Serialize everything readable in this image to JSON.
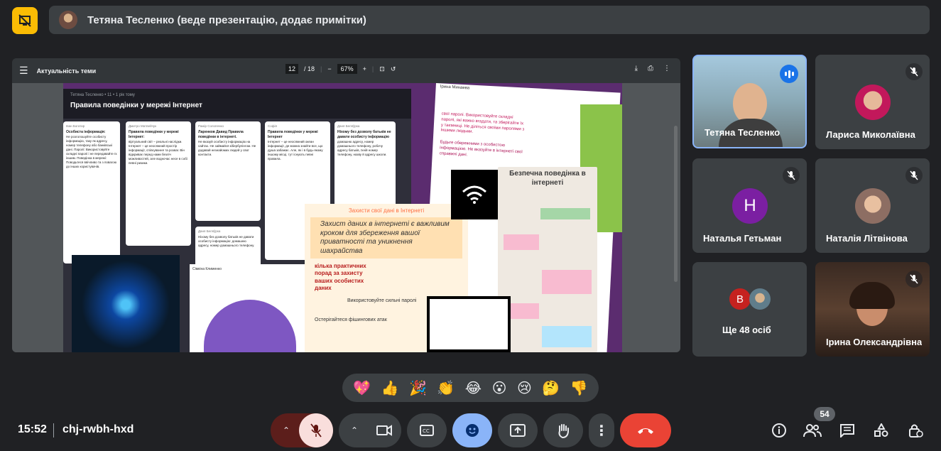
{
  "presenter_bar": {
    "text": "Тетяна Тесленко (веде презентацію, додає примітки)"
  },
  "pdf_viewer": {
    "title": "Актуальність теми",
    "page_current": "12",
    "page_total": "/ 18",
    "zoom_minus": "−",
    "zoom": "67%",
    "zoom_plus": "+"
  },
  "slide": {
    "padlet_meta": "Тетяна Тесленко • 11 • 1 рік тому",
    "padlet_title": "Правила поведінки у мережі Інтернет",
    "card_authors": [
      "Іван Богатир",
      "Дмитро Матвейчук",
      "Рамір Солопенко",
      "Софія",
      "Даня Беляўрка",
      "Даня Беляўрка"
    ],
    "card_titles": [
      "Особиста інформація:",
      "Правила поведінки у мережі Інтернет:",
      "Ларенков Давид Правила поведінки в інтернеті.",
      "Правила поведінки у мережі Інтернет",
      "Ніхому без дозволу батьків не давати особисту інформацію"
    ],
    "tilted_author": "Ірина Минаева",
    "safe_title": "Безпечна поведінка в інтернеті",
    "orange_heading": "Захисти свої дані в Інтернеті",
    "orange_text": "Захист даних в інтернеті є важливим кроком для збереження вашої приватності та уникнення шахрайства",
    "orange_sub": "кілька практичних порад за захисту ваших особистих даних",
    "orange_tip": "Використовуйте сильні паролі",
    "orange_tip2": "Остерігайтеся фішингових атак",
    "laptop_author": "Сімкіна Клименко"
  },
  "participants": [
    {
      "name": "Тетяна Тесленко",
      "speaking": true
    },
    {
      "name": "Лариса Миколаївна",
      "muted": true
    },
    {
      "name": "Наталья Гетьман",
      "initial": "Н",
      "muted": true
    },
    {
      "name": "Наталія Літвінова",
      "muted": true
    },
    {
      "name": "Ще 48 осіб",
      "initial": "В"
    },
    {
      "name": "Ірина Олександрівна",
      "muted": true
    }
  ],
  "reactions": [
    "💖",
    "👍",
    "🎉",
    "👏",
    "😂",
    "😮",
    "😢",
    "🤔",
    "👎"
  ],
  "bottom_bar": {
    "time": "15:52",
    "meeting_code": "chj-rwbh-hxd",
    "participant_count": "54"
  },
  "colors": {
    "accent_yellow": "#fbbc04",
    "end_call_red": "#ea4335",
    "mic_muted_bg": "#f9dedc",
    "emoji_active_bg": "#8ab4f8"
  }
}
